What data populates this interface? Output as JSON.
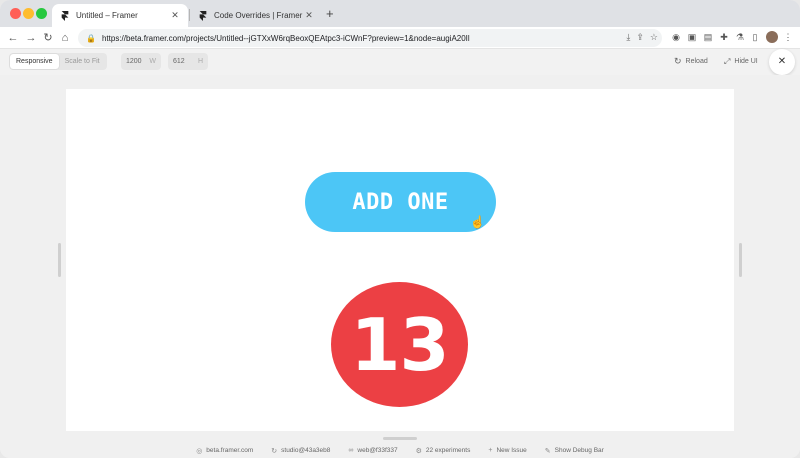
{
  "tabs": [
    {
      "title": "Untitled – Framer",
      "active": true
    },
    {
      "title": "Code Overrides | Framer for D",
      "active": false
    }
  ],
  "address": {
    "url": "https://beta.framer.com/projects/Untitled--jGTXxW6rqBeoxQEAtpc3-iCWnF?preview=1&node=augiA20Il"
  },
  "preview_toolbar": {
    "responsive": "Responsive",
    "scale_to_fit": "Scale to Fit",
    "width_value": "1200",
    "width_unit": "W",
    "height_value": "612",
    "height_unit": "H",
    "reload": "Reload",
    "hide_ui": "Hide UI"
  },
  "canvas": {
    "button_label": "ADD ONE",
    "counter_value": "13",
    "button_color": "#4cc6f6",
    "counter_color": "#ec4044"
  },
  "status_bar": [
    {
      "icon": "globe-icon",
      "label": "beta.framer.com"
    },
    {
      "icon": "refresh-icon",
      "label": "studio@43a3eb8"
    },
    {
      "icon": "link-icon",
      "label": "web@f33f337"
    },
    {
      "icon": "gear-icon",
      "label": "22 experiments"
    },
    {
      "icon": "plus-icon",
      "label": "New Issue"
    },
    {
      "icon": "bug-icon",
      "label": "Show Debug Bar"
    }
  ]
}
